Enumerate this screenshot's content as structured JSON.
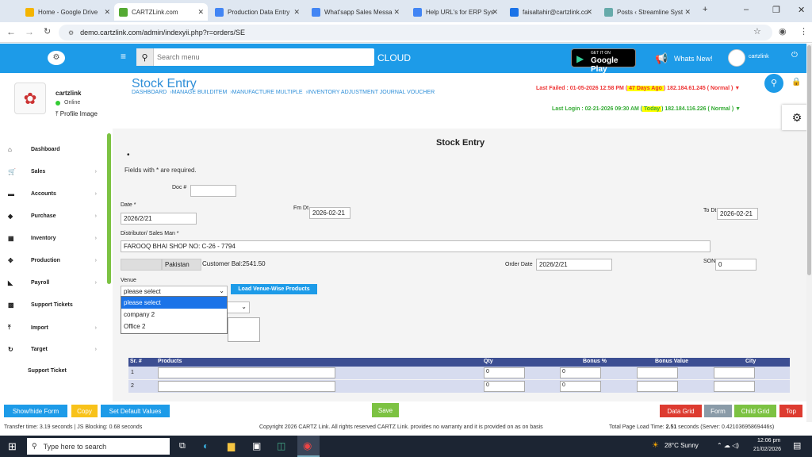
{
  "browser": {
    "tabs": [
      {
        "label": "Home - Google Drive",
        "color": "#f4b400"
      },
      {
        "label": "CARTZLink.com",
        "color": "#5a3",
        "active": true
      },
      {
        "label": "Production Data Entry",
        "color": "#4285f4"
      },
      {
        "label": "What'sapp Sales Messa",
        "color": "#4285f4"
      },
      {
        "label": "Help URL's for ERP Sys",
        "color": "#4285f4"
      },
      {
        "label": "faisaltahir@cartzlink.co",
        "color": "#1a73e8"
      },
      {
        "label": "Posts ‹ Streamline Syst",
        "color": "#6aa"
      }
    ],
    "url": "demo.cartzlink.com/admin/indexyii.php?r=orders/SE"
  },
  "topbar": {
    "search_placeholder": "Search menu",
    "cloud": "CLOUD",
    "gp_small": "GET IT ON",
    "gp_big": "Google Play",
    "whats_new": "Whats New!",
    "user": "cartzlink"
  },
  "sidebar": {
    "username": "cartzlink",
    "status": "Online",
    "profile_image": "Profile Image",
    "items": [
      {
        "label": "Dashboard",
        "icon": "home-icon",
        "glyph": "⌂",
        "chevron": false
      },
      {
        "label": "Sales",
        "icon": "cart-icon",
        "glyph": "🛒",
        "chevron": true
      },
      {
        "label": "Accounts",
        "icon": "bank-icon",
        "glyph": "▬",
        "chevron": true
      },
      {
        "label": "Purchase",
        "icon": "tag-icon",
        "glyph": "◆",
        "chevron": true
      },
      {
        "label": "Inventory",
        "icon": "grid-icon",
        "glyph": "▦",
        "chevron": true
      },
      {
        "label": "Production",
        "icon": "cog-icon",
        "glyph": "✥",
        "chevron": true
      },
      {
        "label": "Payroll",
        "icon": "megaphone-icon",
        "glyph": "◣",
        "chevron": true
      },
      {
        "label": "Support Tickets",
        "icon": "ticket-icon",
        "glyph": "▩",
        "chevron": false
      },
      {
        "label": "Import",
        "icon": "upload-icon",
        "glyph": "⤒",
        "chevron": true
      },
      {
        "label": "Target",
        "icon": "refresh-icon",
        "glyph": "↻",
        "chevron": true
      },
      {
        "label": "Support Ticket",
        "icon": "",
        "glyph": "",
        "chevron": false
      }
    ]
  },
  "header": {
    "title": "Stock Entry",
    "breadcrumbs": [
      "DASHBOARD",
      "›MANAGE BUILDITEM",
      "›MANUFACTURE MULTIPLE",
      "›INVENTORY ADJUSTMENT JOURNAL VOUCHER"
    ],
    "last_failed_prefix": "Last Failed : 01-05-2026 12:58 PM (",
    "last_failed_ago": " 47 Days Ago ",
    "last_failed_suffix": ") 182.184.61.245 ( Normal ) ▼",
    "last_login_prefix": "Last Login : 02-21-2026 09:30 AM (",
    "last_login_today": " Today ",
    "last_login_suffix": ") 182.184.116.226 ( Normal ) ▼"
  },
  "form": {
    "heading": "Stock Entry",
    "bullet": "•",
    "required_note": "Fields with * are required.",
    "doc_label": "Doc #",
    "doc_value": "",
    "date_label": "Date *",
    "date_value": "2026/2/21",
    "fm_dt_label": "Fm Dt",
    "fm_dt_value": "2026-02-21",
    "to_dt_label": "To Dt",
    "to_dt_value": "2026-02-21",
    "distributor_label": "Distributor/ Sales Man *",
    "distributor_value": "FAROOQ BHAI SHOP NO: C-26 - 7794",
    "country_value": "Pakistan",
    "customer_bal": "Customer Bal:2541.50",
    "order_date_label": "Order Date",
    "order_date_value": "2026/2/21",
    "son_label": "SON",
    "son_value": "0",
    "venue_label": "Venue",
    "venue_selected": "please select",
    "venue_options": [
      "please select",
      "company 2",
      "Office 2"
    ],
    "load_button": "Load Venue-Wise Products"
  },
  "grid": {
    "headers": [
      "Sr. #",
      "Products",
      "Qty",
      "Bonus %",
      "Bonus Value",
      "City"
    ],
    "rows": [
      {
        "sr": "1",
        "qty": "0",
        "bonus_pct": "0"
      },
      {
        "sr": "2",
        "qty": "0",
        "bonus_pct": "0"
      }
    ]
  },
  "buttons": {
    "show_hide": "Show/hide Form",
    "copy": "Copy",
    "set_default": "Set Default Values",
    "save": "Save",
    "data_grid": "Data Grid",
    "form": "Form",
    "child_grid": "Child Grid",
    "top": "Top"
  },
  "footer": {
    "left": "Transfer time: 3.19 seconds | JS Blocking: 0.68 seconds",
    "center": "Copyright 2026 CARTZ Link. All rights reserved CARTZ Link. provides no warranty and it is provided on as on basis",
    "right_prefix": "Total Page Load Time: ",
    "right_bold": "2.51",
    "right_suffix": " seconds (Server: 0.42103695869446s)"
  },
  "taskbar": {
    "search": "Type here to search",
    "weather": "28°C  Sunny",
    "time": "12:06 pm",
    "date": "21/02/2026"
  }
}
